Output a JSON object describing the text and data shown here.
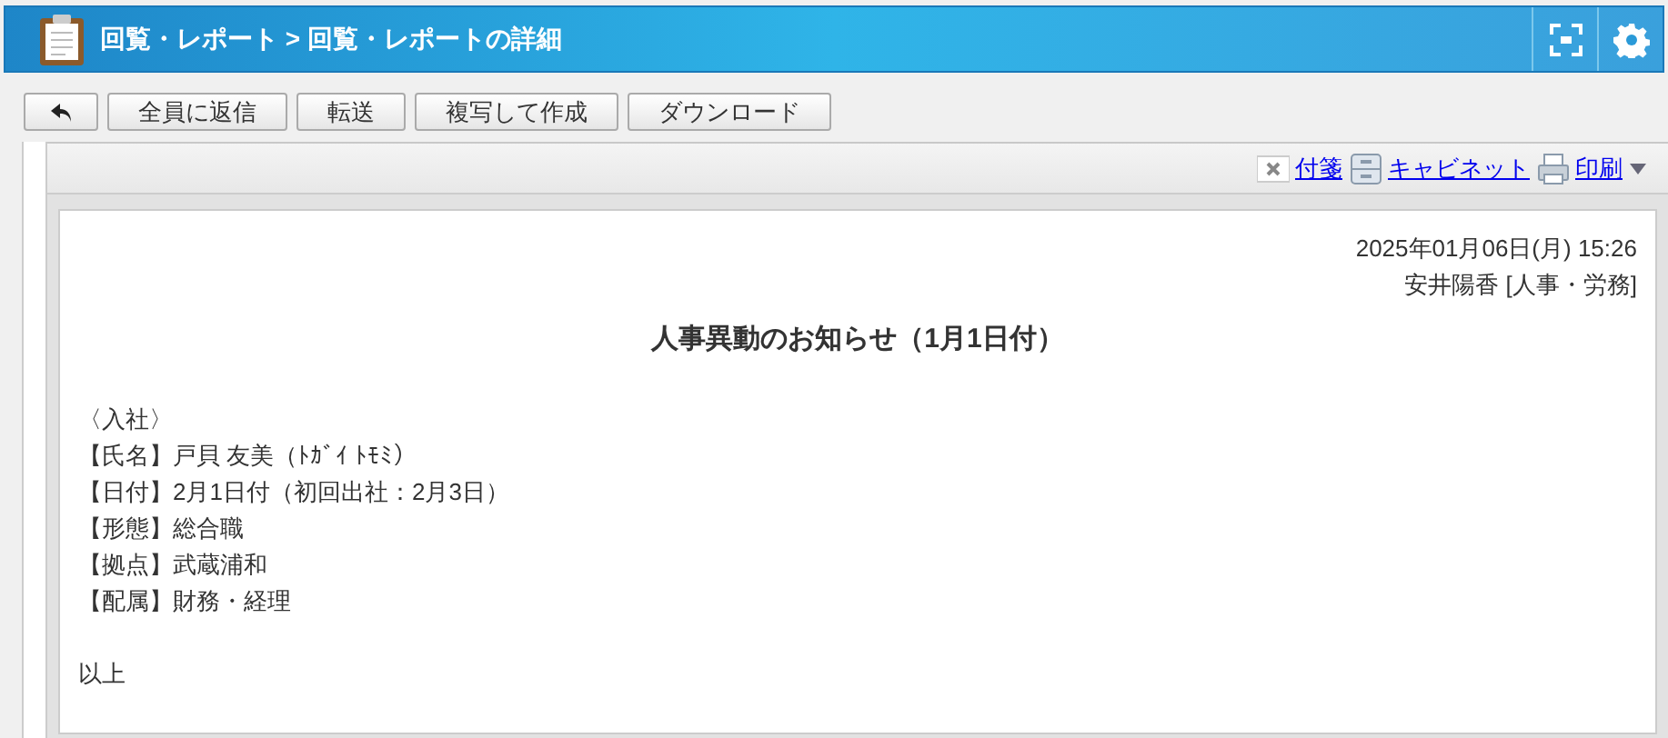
{
  "header": {
    "title": "回覧・レポート > 回覧・レポートの詳細"
  },
  "toolbar": {
    "buttons": [
      {
        "kind": "icon"
      },
      {
        "kind": "text",
        "label": "全員に返信"
      },
      {
        "kind": "text",
        "label": "転送"
      },
      {
        "kind": "text",
        "label": "複写して作成"
      },
      {
        "kind": "text",
        "label": "ダウンロード"
      }
    ]
  },
  "actions": [
    {
      "kind": "note",
      "label": "付箋"
    },
    {
      "kind": "cabinet",
      "label": "キャビネット"
    },
    {
      "kind": "print",
      "label": "印刷"
    }
  ],
  "message": {
    "date": "2025年01月06日(月) 15:26",
    "sender": "安井陽香 [人事・労務]",
    "title": "人事異動のお知らせ（1月1日付）",
    "lines": [
      "〈入社〉",
      "【氏名】戸貝 友美（ﾄｶﾞｲ ﾄﾓﾐ）",
      "【日付】2月1日付（初回出社：2月3日）",
      "【形態】総合職",
      "【拠点】武蔵浦和",
      "【配属】財務・経理"
    ],
    "closing": "以上"
  }
}
